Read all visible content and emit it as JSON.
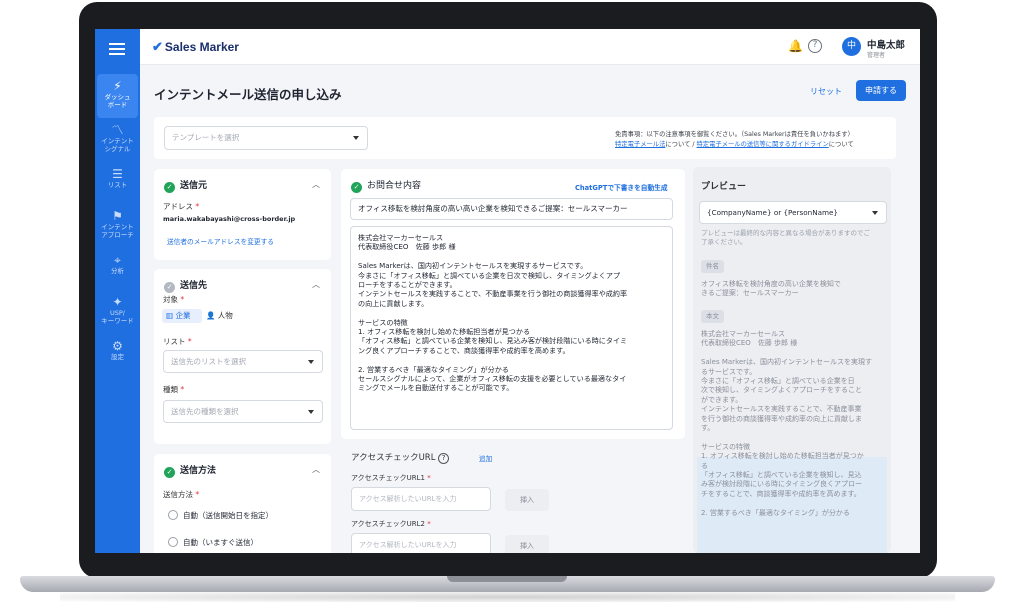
{
  "app": {
    "logo_text": "Sales Marker",
    "user_initial": "中",
    "user_name": "中島太郎",
    "user_role": "管理者"
  },
  "sidebar": {
    "items": [
      {
        "icon": "⚡",
        "label": "ダッシュ\nボード",
        "active": true
      },
      {
        "icon": "〽",
        "label": "インテント\nシグナル",
        "active": false
      },
      {
        "icon": "☰",
        "label": "リスト",
        "active": false
      },
      {
        "icon": "⚑",
        "label": "インテント\nアプローチ",
        "active": false
      },
      {
        "icon": "⌖",
        "label": "分析",
        "active": false
      },
      {
        "icon": "✦",
        "label": "USP/\nキーワード",
        "active": false
      },
      {
        "icon": "⚙",
        "label": "設定",
        "active": false
      }
    ]
  },
  "header": {
    "title": "インテントメール送信の申し込み",
    "reset_label": "リセット",
    "apply_label": "申請する"
  },
  "template": {
    "placeholder": "テンプレートを選択",
    "notice_line1": "免責事項：以下の注意事項を御覧ください。（Sales Markerは責任を負いかねます）",
    "notice_link1": "特定電子メール法",
    "notice_mid": "について / ",
    "notice_link2": "特定電子メールの送信等に関するガイドライン",
    "notice_end": "について"
  },
  "sender": {
    "title": "送信元",
    "address_label": "アドレス",
    "address_value": "maria.wakabayashi@cross-border.jp",
    "change_link": "送信者のメールアドレスを変更する"
  },
  "recipient": {
    "title": "送信先",
    "target_label": "対象",
    "seg_company": "企業",
    "seg_person": "人物",
    "list_label": "リスト",
    "list_placeholder": "送信先のリストを選択",
    "type_label": "種類",
    "type_placeholder": "送信先の種類を選択"
  },
  "method": {
    "title": "送信方法",
    "label": "送信方法",
    "option1": "自動（送信開始日を指定）",
    "option2": "自動（いますぐ送信）"
  },
  "compose": {
    "title": "お問合せ内容",
    "gpt_link": "ChatGPTで下書きを自動生成",
    "subject": "オフィス移転を検討角度の高い高い企業を検知できるご提案：セールスマーカー",
    "body_lines": [
      "株式会社マーカーセールス",
      "代表取締役CEO　佐藤 歩郎 様",
      "",
      "Sales Markerは、国内初インテントセールスを実現するサービスです。",
      "今まさに「オフィス移転」と調べている企業を日次で検知し、タイミングよくアプ",
      "ローチをすることができます。",
      "インテントセールスを実践することで、不動産事業を行う御社の商談獲得率や成約率",
      "の向上に貢献します。",
      "",
      "サービスの特徴",
      "1. オフィス移転を検討し始めた移転担当者が見つかる",
      "「オフィス移転」と調べている企業を検知し、見込み客が検討段階にいる時にタイミ",
      "ング良くアプローチすることで、商談獲得率や成約率を高めます。",
      "",
      "2. 営業するべき「最適なタイミング」が分かる",
      "セールスシグナルによって、企業がオフィス移転の支援を必要としている最適なタイ",
      "ミングでメールを自動送付することが可能です。"
    ],
    "access_title": "アクセスチェックURL",
    "add_link": "追加",
    "url1_label": "アクセスチェックURL1",
    "url2_label": "アクセスチェックURL2",
    "url_placeholder": "アクセス解析したいURLを入力",
    "insert_label": "挿入"
  },
  "preview": {
    "title": "プレビュー",
    "select_value": "{CompanyName} or {PersonName}",
    "note_lines": [
      "プレビューは最終的な内容と異なる場合がありますのでご",
      "了承ください。"
    ],
    "subject_chip": "件名",
    "subject_lines": [
      "オフィス移転を検討角度の高い企業を検知で",
      "きるご提案：セールスマーカー"
    ],
    "body_chip": "本文",
    "body_lines": [
      "株式会社マーカーセールス",
      "代表取締役CEO　佐藤 歩郎 様",
      "",
      "Sales Markerは、国内初インテントセールスを実現す",
      "るサービスです。",
      " 今まさに「オフィス移転」と調べている企業を日",
      "次で検知し、タイミングよくアプローチをすること",
      "ができます。",
      "インテントセールスを実践することで、不動産事業",
      "を行う御社の商談獲得率や成約率の向上に貢献しま",
      "す。",
      "",
      "サービスの特徴",
      "1. オフィス移転を検討し始めた移転担当者が見つか",
      "る",
      "「オフィス移転」と調べている企業を検知し、見込",
      "み客が検討段階にいる時にタイミング良くアプロー",
      "チをすることで、商談獲得率や成約率を高めます。",
      "",
      "2. 営業するべき「最適なタイミング」が分かる"
    ]
  }
}
